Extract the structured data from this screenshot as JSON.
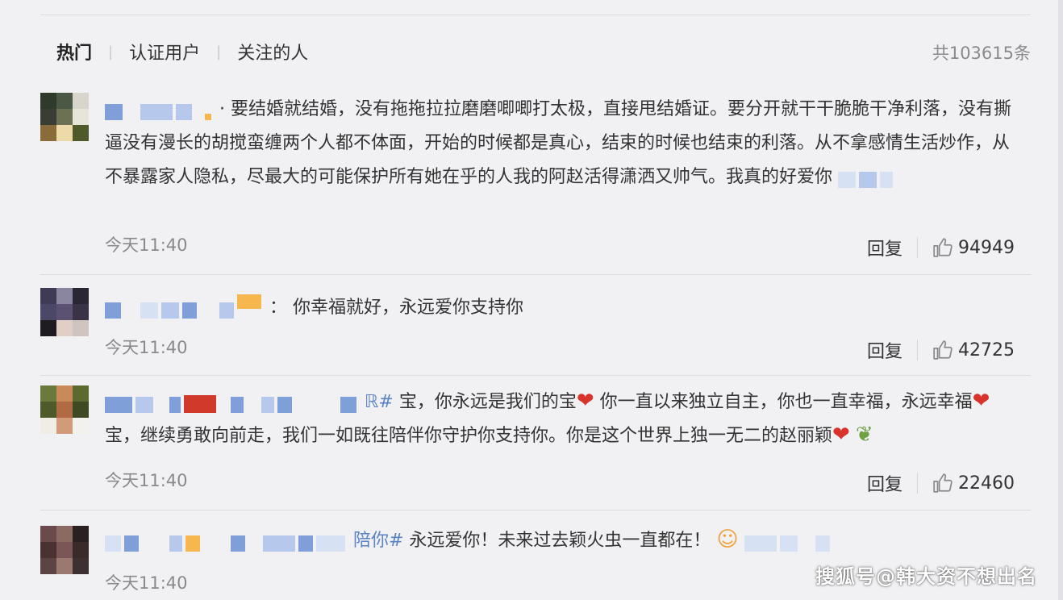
{
  "tabs": [
    {
      "label": "热门",
      "active": true
    },
    {
      "label": "认证用户",
      "active": false
    },
    {
      "label": "关注的人",
      "active": false
    }
  ],
  "total": "共103615条",
  "reply_label": "回复",
  "comments": [
    {
      "text_before": "·  要结婚就结婚，没有拖拖拉拉磨磨唧唧打太极，直接甩结婚证。要分开就干干脆脆干净利落，没有撕逼没有漫长的胡搅蛮缠两个人都不体面，开始的时候都是真心，结束的时候也结束的利落。从不拿感情生活炒作，从不暴露家人隐私，尽最大的可能保护所有她在乎的人我的阿赵活得潇洒又帅气。我真的好爱你",
      "time": "今天11:40",
      "likes": "94949"
    },
    {
      "text_before": "：  你幸福就好，永远爱你支持你",
      "time": "今天11:40",
      "likes": "42725"
    },
    {
      "tag_fragment": "ℝ#",
      "text_1": " 宝，你永远是我们的宝",
      "text_2": " 你一直以来独立自主，你也一直幸福，永远幸福",
      "text_3": " 宝，继续勇敢向前走，我们一如既往陪伴你守护你支持你。你是这个世界上独一无二的赵丽颖",
      "time": "今天11:40",
      "likes": "22460"
    },
    {
      "tag_fragment": "陪你#",
      "text_1": " 永远爱你！未来过去颖火虫一直都在！",
      "time": "今天11:40"
    }
  ],
  "watermark": "搜狐号@韩大资不想出名",
  "icons": {
    "like": "thumbs-up-icon",
    "heart": "heart-emoji-icon",
    "leaf": "leaf-emoji-icon",
    "face": "heart-eyes-emoji-icon"
  },
  "colors": {
    "background": "#f1f1f4",
    "text": "#333333",
    "muted": "#8a8a8e",
    "heart": "#d9342b"
  }
}
